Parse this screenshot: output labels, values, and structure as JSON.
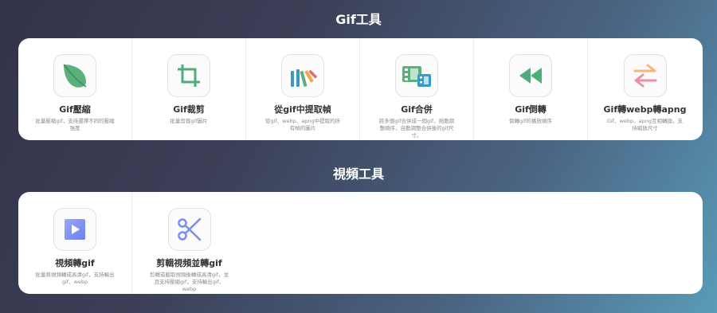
{
  "sections": [
    {
      "title": "Gif工具",
      "tools": [
        {
          "title": "Gif壓縮",
          "desc": "批量壓縮gif，支持選擇不同的壓縮強度",
          "icon": "leaf-icon"
        },
        {
          "title": "Gif裁剪",
          "desc": "批量剪裁gif圖片",
          "icon": "crop-icon"
        },
        {
          "title": "從gif中提取幀",
          "desc": "從gif、webp、apng中提取的所有幀的圖片",
          "icon": "frames-icon"
        },
        {
          "title": "Gif合併",
          "desc": "將多個gif合併成一個gif，拖動調整順序，自動調整合併後的gif尺寸。",
          "icon": "film-merge-icon"
        },
        {
          "title": "Gif倒轉",
          "desc": "倒轉gif的播放順序",
          "icon": "rewind-icon"
        },
        {
          "title": "Gif轉webp轉apng",
          "desc": "Gif、webp、apng互相轉換，支持縮放尺寸",
          "icon": "convert-arrows-icon"
        }
      ]
    },
    {
      "title": "視頻工具",
      "tools": [
        {
          "title": "視頻轉gif",
          "desc": "批量將視頻轉成高清gif，支持輸出gif、webp",
          "icon": "video-play-icon"
        },
        {
          "title": "剪輯視頻並轉gif",
          "desc": "剪輯或截取視頻後轉成高清gif，並且支持壓縮gif，支持輸出gif、webp",
          "icon": "scissors-icon"
        }
      ]
    }
  ]
}
